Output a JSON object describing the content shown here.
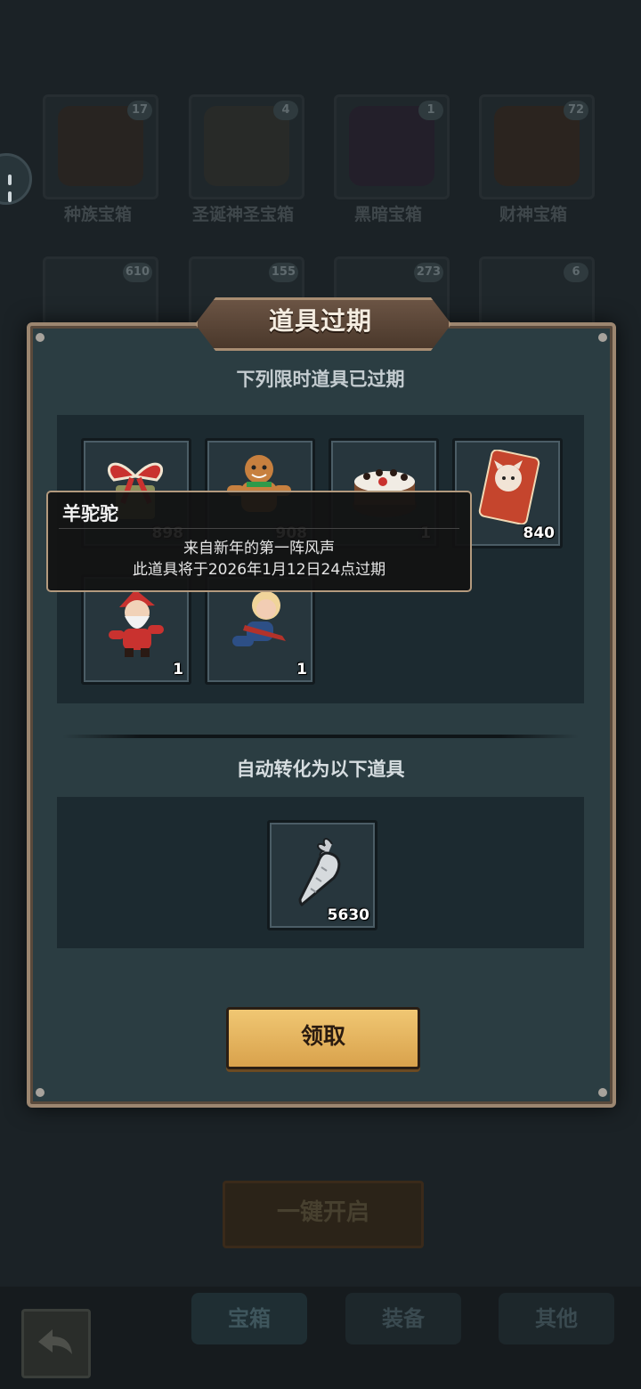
{
  "background": {
    "chests": [
      {
        "name": "种族宝箱",
        "count": "17"
      },
      {
        "name": "圣诞神圣宝箱",
        "count": "4"
      },
      {
        "name": "黑暗宝箱",
        "count": "1"
      },
      {
        "name": "财神宝箱",
        "count": "72"
      }
    ],
    "chest_counts_row2": [
      "610",
      "155",
      "273",
      "6"
    ],
    "open_all_label": "一键开启",
    "tabs": [
      "宝箱",
      "装备",
      "其他"
    ]
  },
  "modal": {
    "title": "道具过期",
    "expired_heading": "下列限时道具已过期",
    "expired_items": [
      {
        "icon": "gift-bow-icon",
        "qty": "898"
      },
      {
        "icon": "gingerbread-man-icon",
        "qty": "908"
      },
      {
        "icon": "cake-icon",
        "qty": "1"
      },
      {
        "icon": "new-year-card-icon",
        "qty": "840"
      },
      {
        "icon": "santa-doll-icon",
        "qty": "1"
      },
      {
        "icon": "blonde-doll-icon",
        "qty": "1"
      }
    ],
    "converted_heading": "自动转化为以下道具",
    "converted_items": [
      {
        "icon": "silver-carrot-icon",
        "qty": "5630"
      }
    ],
    "claim_label": "领取"
  },
  "tooltip": {
    "name": "羊驼驼",
    "description": "来自新年的第一阵风声",
    "expiry": "此道具将于2026年1月12日24点过期"
  }
}
